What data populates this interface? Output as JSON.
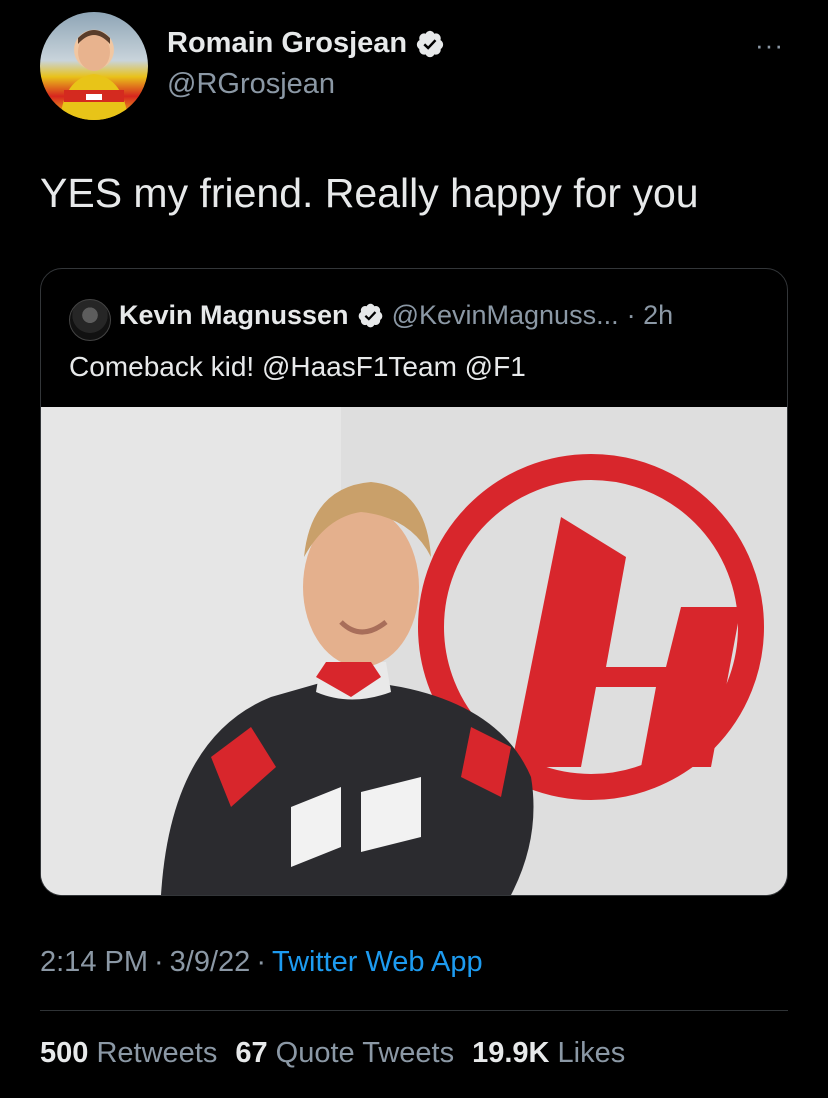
{
  "tweet": {
    "author_name": "Romain Grosjean",
    "author_handle": "@RGrosjean",
    "more_label": "···",
    "text": "YES my friend. Really happy for you",
    "time": "2:14 PM",
    "date": "3/9/22",
    "source": "Twitter Web App",
    "separator": "·"
  },
  "quoted": {
    "author_name": "Kevin Magnussen",
    "author_handle": "@KevinMagnuss...",
    "age": "· 2h",
    "text": "Comeback kid! @HaasF1Team @F1",
    "image_icon": "photo"
  },
  "stats": {
    "retweets_count": "500",
    "retweets_label": "Retweets",
    "quotes_count": "67",
    "quotes_label": "Quote Tweets",
    "likes_count": "19.9K",
    "likes_label": "Likes"
  },
  "colors": {
    "background": "#000000",
    "text": "#e7e9ea",
    "secondary": "#8b98a5",
    "link": "#1d9bf0",
    "verified": "#e7e9ea"
  }
}
